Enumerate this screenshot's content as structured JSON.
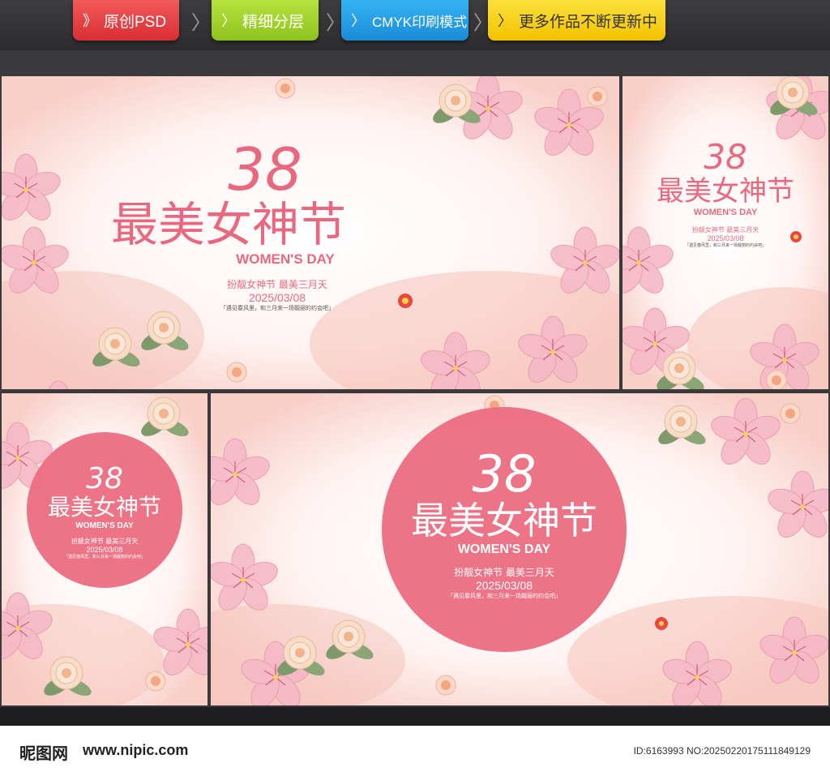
{
  "tabs": [
    {
      "icon": "》",
      "label": "原创PSD"
    },
    {
      "icon": "〉",
      "label": "精细分层"
    },
    {
      "icon": "〉",
      "label": "CMYK印刷模式"
    },
    {
      "icon": "〉",
      "label": "更多作品不断更新中"
    }
  ],
  "poster": {
    "number": "38",
    "title": "最美女神节",
    "subtitle_en": "WOMEN'S DAY",
    "slogan": "扮靓女神节 最美三月天",
    "date": "2025/03/08",
    "tagline": "「遇见春风里，和三月来一场靓丽的约会吧」"
  },
  "footer": {
    "logo": "昵图网",
    "url": "www.nipic.com",
    "id": "ID:6163993 NO:20250220175111849129"
  },
  "colors": {
    "accent": "#e8697f",
    "circle": "#ec6b80",
    "petal": "#f6b9c8",
    "bg": "#3a3a3c"
  }
}
